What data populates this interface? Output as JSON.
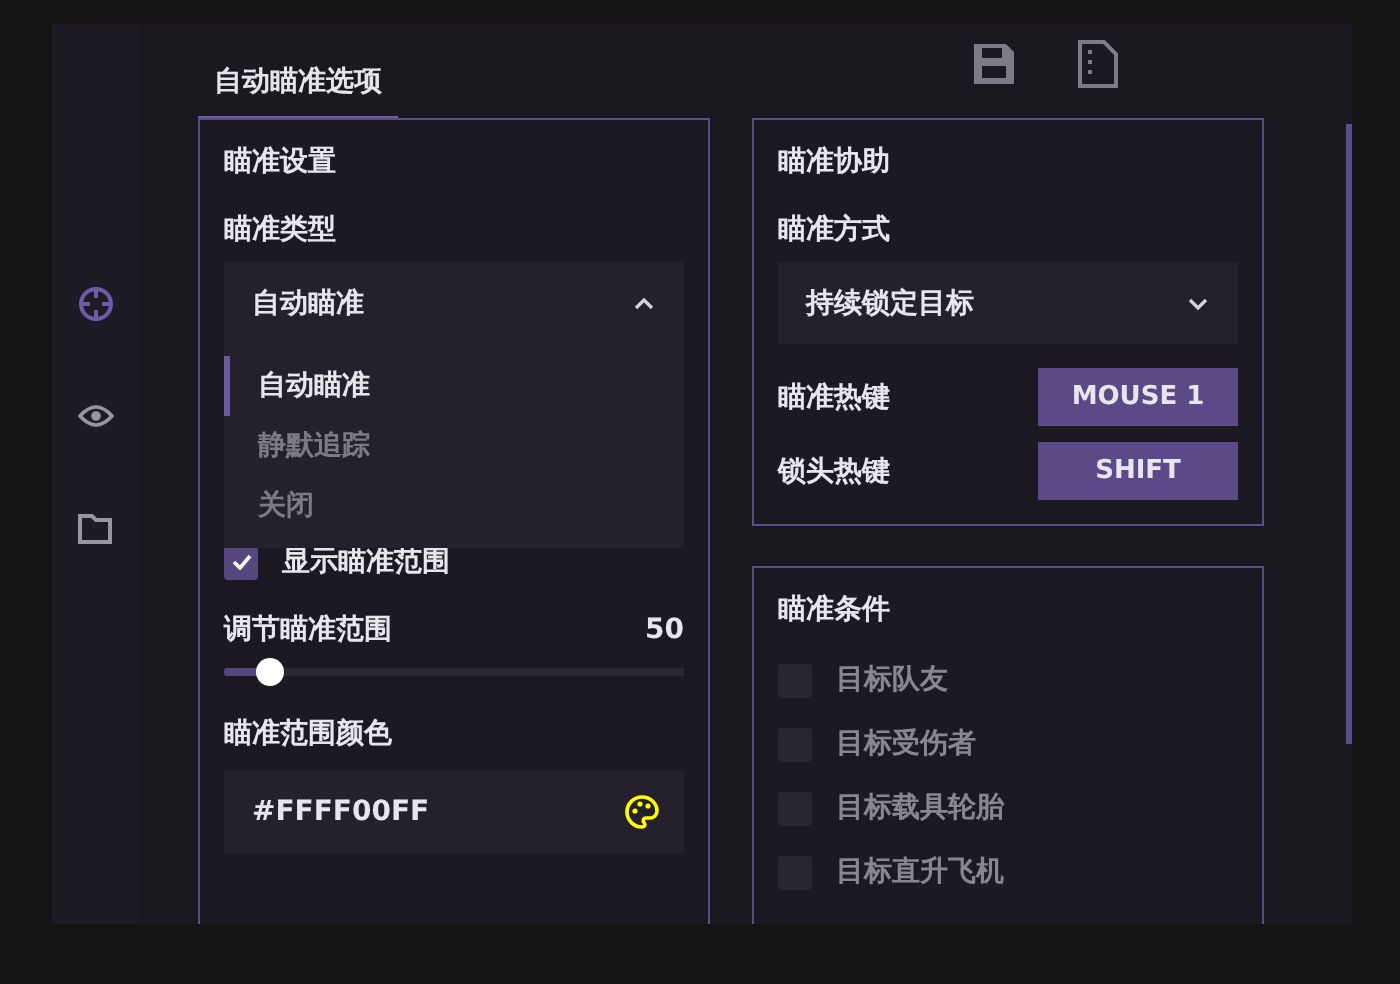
{
  "sidebar": {
    "items": [
      {
        "kind": "crosshair",
        "selected": true
      },
      {
        "kind": "eye",
        "selected": false
      },
      {
        "kind": "folder",
        "selected": false
      }
    ]
  },
  "tabs": [
    {
      "label": "自动瞄准选项",
      "selected": true
    }
  ],
  "aim_settings": {
    "title": "瞄准设置",
    "type_label": "瞄准类型",
    "type_select": {
      "value": "自动瞄准",
      "expanded": true,
      "options": [
        {
          "label": "自动瞄准",
          "selected": true
        },
        {
          "label": "静默追踪",
          "selected": false
        },
        {
          "label": "关闭",
          "selected": false
        }
      ]
    },
    "show_range": {
      "label": "显示瞄准范围",
      "checked": true
    },
    "range_slider": {
      "label": "调节瞄准范围",
      "reading": "50",
      "level": 0.1
    },
    "color_label": "瞄准范围颜色",
    "color_field": {
      "value": "#FFFF00FF"
    }
  },
  "aim_assist": {
    "title": "瞄准协助",
    "mode_label": "瞄准方式",
    "mode_select": {
      "value": "持续锁定目标",
      "expanded": false
    },
    "hotkeys": [
      {
        "label": "瞄准热键",
        "key": "MOUSE 1"
      },
      {
        "label": "锁头热键",
        "key": "SHIFT"
      }
    ]
  },
  "aim_conditions": {
    "title": "瞄准条件",
    "items": [
      {
        "label": "目标队友",
        "checked": false
      },
      {
        "label": "目标受伤者",
        "checked": false
      },
      {
        "label": "目标载具轮胎",
        "checked": false
      },
      {
        "label": "目标直升飞机",
        "checked": false
      }
    ]
  }
}
